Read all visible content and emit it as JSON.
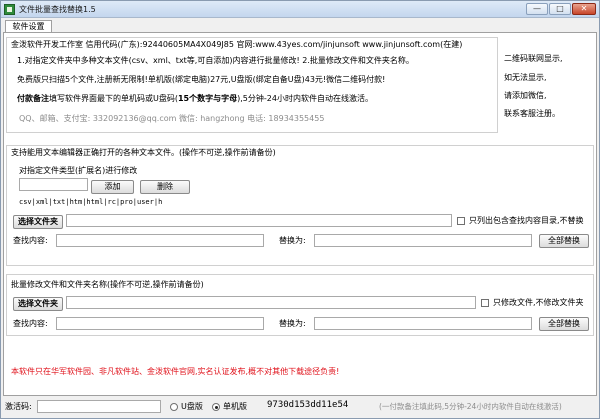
{
  "window": {
    "title": "文件批量查找替换1.5",
    "min_label": "—",
    "max_label": "□",
    "close_label": "✕"
  },
  "tabs": [
    "软件设置"
  ],
  "info": {
    "header": "金泼软件开发工作室 信用代码(广东):92440605MA4X049J85 官网:www.43yes.com/jinjunsoft  www.jinjunsoft.com(在建)",
    "feature_line": "1.对指定文件夹中多种文本文件(csv、xml、txt等,可自添加)内容进行批量修改!  2.批量修改文件和文件夹名称。",
    "price_line": "免费版只扫描5个文件,注册新无限制!单机版(绑定电脑)27元,U盘版(绑定自备U盘)43元!微信二维码付款!",
    "pay_note_label": "付款备注",
    "pay_note_text": "填写软件界面最下的单机码或U盘码(",
    "pay_note_bold": "15个数字与字母",
    "pay_note_tail": "),5分钟-24小时内软件自动在线激活。",
    "contact_line": "QQ、邮箱、支付宝: 332092136@qq.com     微信: hangzhong     电话: 18934355455"
  },
  "qr_note": [
    "二维码联网显示,",
    "如无法显示,",
    "请添加微信,",
    "联系客服注册。"
  ],
  "section1": {
    "heading": "支持能用文本编辑器正确打开的各种文本文件。(操作不可逆,操作前请备份)",
    "ext_label": "对指定文件类型(扩展名)进行修改",
    "ext_input_value": "",
    "add_button": "添加",
    "delete_button": "删除",
    "ext_list": "csv|xml|txt|htm|html|rc|pro|user|h",
    "choose_folder_button": "选择文件夹",
    "folder_path": "",
    "only_contains_label": "只列出包含查找内容目录,不替换",
    "only_contains_checked": false,
    "find_label": "查找内容:",
    "find_value": "",
    "replace_label": "替换为:",
    "replace_value": "",
    "replace_all_button": "全部替换"
  },
  "section2": {
    "heading": "批量修改文件和文件夹名称(操作不可逆,操作前请备份)",
    "choose_folder_button": "选择文件夹",
    "folder_path": "",
    "only_files_label": "只修改文件,不修改文件夹",
    "only_files_checked": false,
    "find_label": "查找内容:",
    "find_value": "",
    "replace_label": "替换为:",
    "replace_value": "",
    "replace_all_button": "全部替换"
  },
  "disclaimer": "本软件只在华军软件园、非凡软件站、金泼软件官网,实名认证发布,概不对其他下载途径负责!",
  "status": {
    "activation_label": "激活码:",
    "activation_value": "",
    "usb_label": "U盘版",
    "usb_selected": false,
    "standalone_label": "单机版",
    "standalone_selected": true,
    "machine_code": "9730d153dd11e54",
    "hint": "(一付款备注填此码,5分钟-24小时内软件自动在线激活)"
  },
  "colors": {
    "warning_red": "#e0121b",
    "window_border": "#8a9bb0"
  }
}
